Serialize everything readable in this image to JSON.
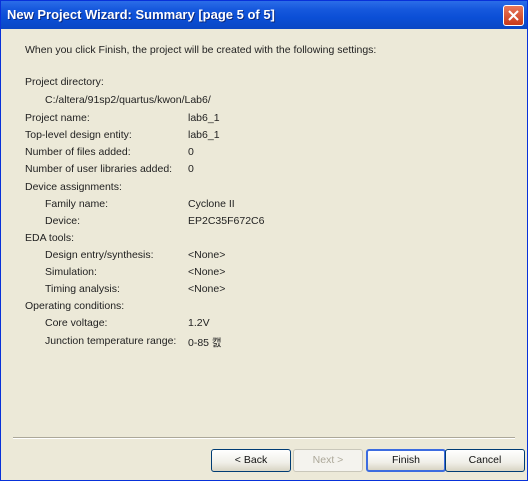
{
  "window": {
    "title": "New Project Wizard: Summary [page 5 of 5]"
  },
  "intro": "When you click Finish, the project will be created with the following settings:",
  "summary": {
    "project_directory_label": "Project directory:",
    "project_directory_value": "C:/altera/91sp2/quartus/kwon/Lab6/",
    "project_name_label": "Project name:",
    "project_name_value": "lab6_1",
    "top_level_label": "Top-level design entity:",
    "top_level_value": "lab6_1",
    "files_added_label": "Number of files added:",
    "files_added_value": "0",
    "user_libraries_label": "Number of user libraries added:",
    "user_libraries_value": "0",
    "device_assignments_label": "Device assignments:",
    "family_name_label": "Family name:",
    "family_name_value": "Cyclone II",
    "device_label": "Device:",
    "device_value": "EP2C35F672C6",
    "eda_tools_label": "EDA tools:",
    "design_entry_label": "Design entry/synthesis:",
    "design_entry_value": "<None>",
    "simulation_label": "Simulation:",
    "simulation_value": "<None>",
    "timing_label": "Timing analysis:",
    "timing_value": "<None>",
    "operating_conditions_label": "Operating conditions:",
    "core_voltage_label": "Core voltage:",
    "core_voltage_value": "1.2V",
    "junction_temp_label": "Junction temperature range:",
    "junction_temp_value": "0-85 캜"
  },
  "buttons": {
    "back": "< Back",
    "next": "Next >",
    "finish": "Finish",
    "cancel": "Cancel"
  },
  "colors": {
    "title_bar": "#0b4fd6",
    "dialog_bg": "#ece9d8",
    "close_button": "#c8391a"
  },
  "icons": {
    "close": "close-icon"
  }
}
